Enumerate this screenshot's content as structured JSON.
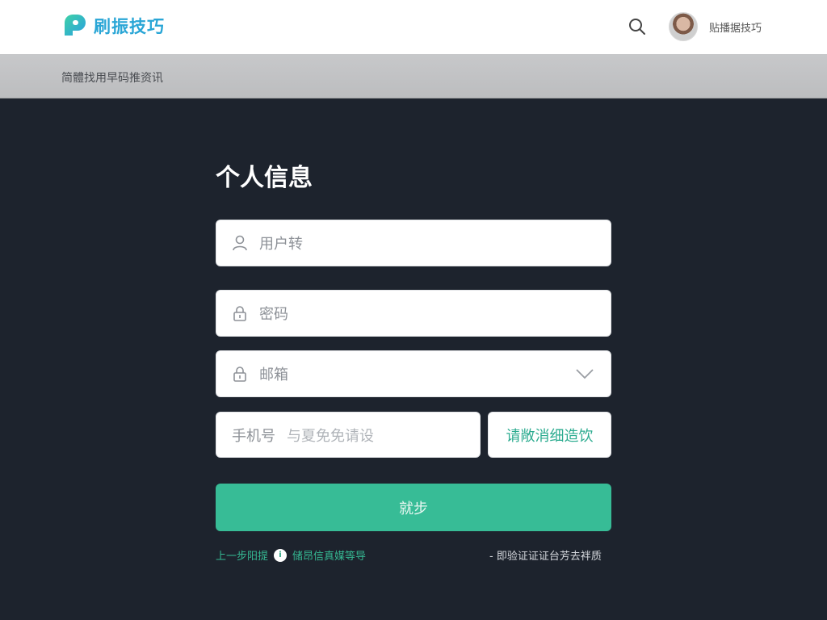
{
  "header": {
    "logo_text": "刷振技巧",
    "user_name": "贴播据技巧"
  },
  "breadcrumb": "简體找用早码推资讯",
  "form": {
    "title": "个人信息",
    "username_placeholder": "用户转",
    "password_placeholder": "密码",
    "email_placeholder": "邮箱",
    "phone_prefix": "手机号",
    "phone_placeholder": "与夏免免请设",
    "code_button": "请敞消细造饮",
    "submit_button": "就步"
  },
  "footer": {
    "prev_link": "上一步阳提",
    "badge_char": "i",
    "info_link": "储昂信真媒等导",
    "right_note": "- 即验证证证台芳去袢质"
  },
  "colors": {
    "accent": "#37bc96",
    "logo": "#2aa6d6",
    "background": "#1d232d"
  }
}
